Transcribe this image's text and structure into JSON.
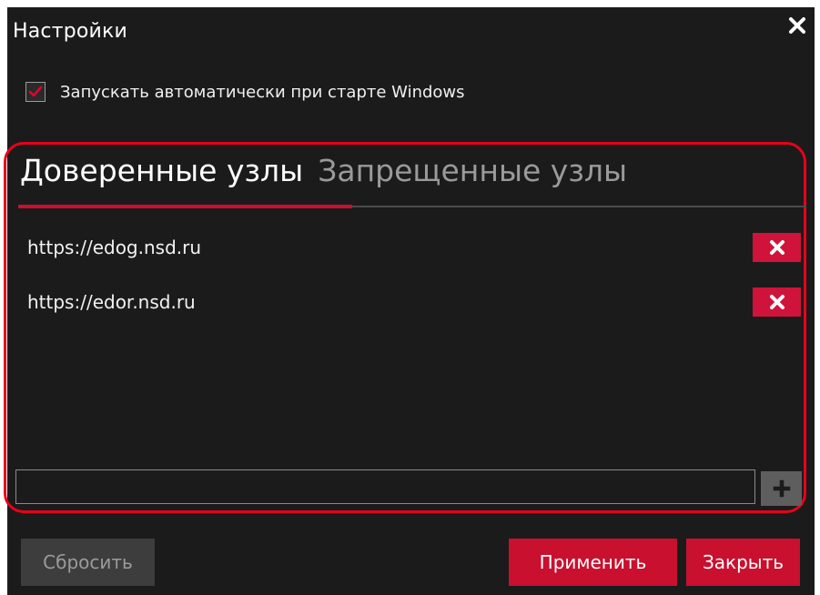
{
  "window": {
    "title": "Настройки",
    "close_glyph": "✕"
  },
  "autostart": {
    "label": "Запускать автоматически при старте Windows",
    "checked": true
  },
  "tabs": [
    {
      "label": "Доверенные узлы",
      "active": true
    },
    {
      "label": "Запрещенные узлы",
      "active": false
    }
  ],
  "trusted_nodes": [
    {
      "url": "https://edog.nsd.ru"
    },
    {
      "url": "https://edor.nsd.ru"
    }
  ],
  "add_node": {
    "value": "",
    "placeholder": ""
  },
  "buttons": {
    "reset": "Сбросить",
    "apply": "Применить",
    "close": "Закрыть"
  },
  "colors": {
    "background": "#1b1b1b",
    "accent": "#c9102f",
    "highlight_outline": "#e8001c",
    "disabled_button": "#3d3d3d"
  },
  "icons": {
    "close": "close-icon",
    "check": "checkmark-icon",
    "delete": "delete-x-icon",
    "add": "plus-icon"
  }
}
